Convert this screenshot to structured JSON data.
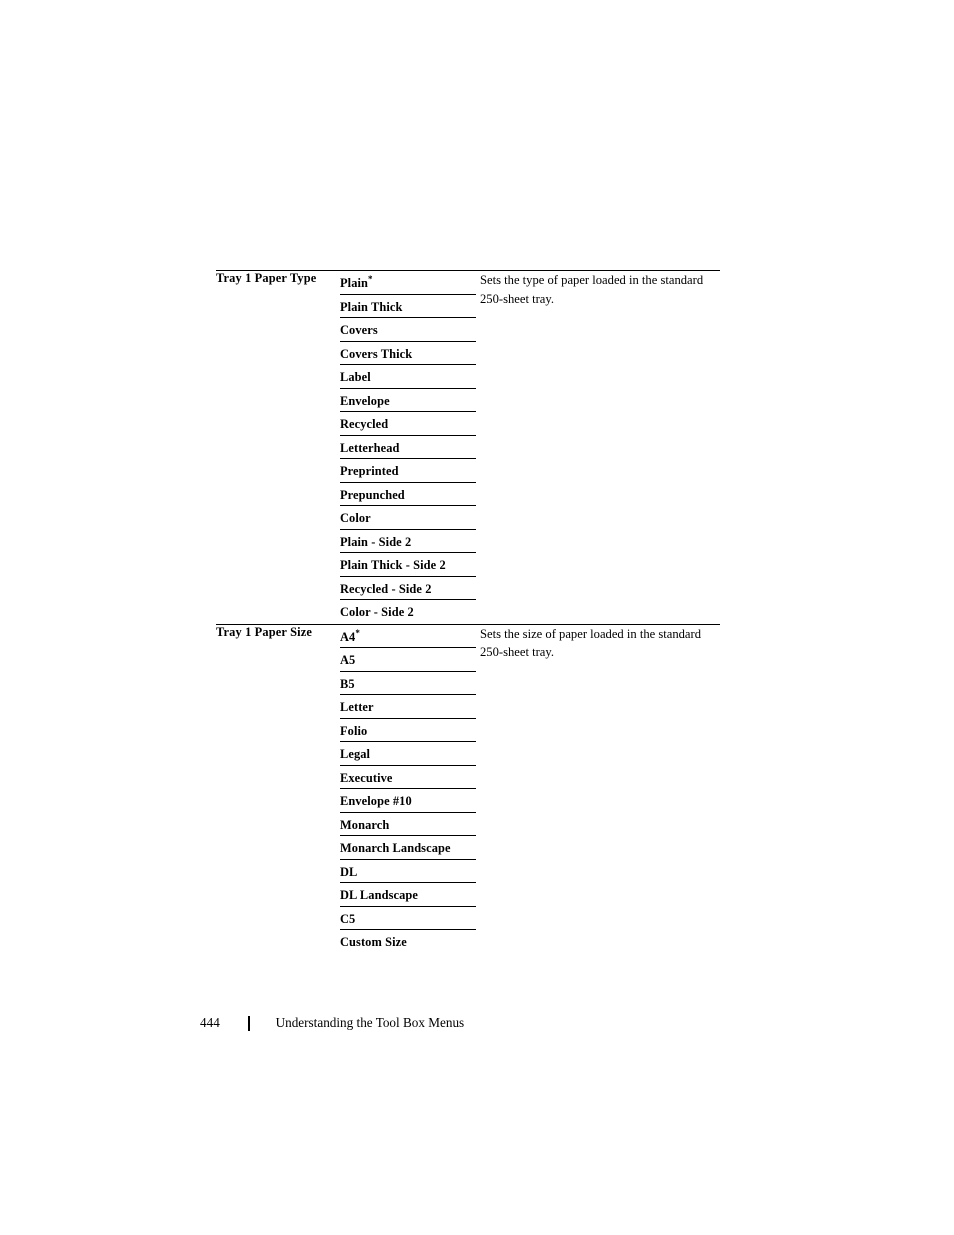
{
  "page": {
    "number": "444",
    "footer_title": "Understanding the Tool Box Menus",
    "separator_glyph": "|"
  },
  "table": {
    "sections": [
      {
        "setting": "Tray 1 Paper Type",
        "description": "Sets the type of paper loaded in the standard 250-sheet tray.",
        "default_marker": "*",
        "options": [
          {
            "label": "Plain",
            "is_default": true
          },
          {
            "label": "Plain Thick",
            "is_default": false
          },
          {
            "label": "Covers",
            "is_default": false
          },
          {
            "label": "Covers Thick",
            "is_default": false
          },
          {
            "label": "Label",
            "is_default": false
          },
          {
            "label": "Envelope",
            "is_default": false
          },
          {
            "label": "Recycled",
            "is_default": false
          },
          {
            "label": "Letterhead",
            "is_default": false
          },
          {
            "label": "Preprinted",
            "is_default": false
          },
          {
            "label": "Prepunched",
            "is_default": false
          },
          {
            "label": "Color",
            "is_default": false
          },
          {
            "label": "Plain - Side 2",
            "is_default": false
          },
          {
            "label": "Plain Thick - Side 2",
            "is_default": false
          },
          {
            "label": "Recycled - Side 2",
            "is_default": false
          },
          {
            "label": "Color - Side 2",
            "is_default": false
          }
        ]
      },
      {
        "setting": "Tray 1 Paper Size",
        "description": "Sets the size of paper loaded in the standard 250-sheet tray.",
        "default_marker": "*",
        "options": [
          {
            "label": "A4",
            "is_default": true
          },
          {
            "label": "A5",
            "is_default": false
          },
          {
            "label": "B5",
            "is_default": false
          },
          {
            "label": "Letter",
            "is_default": false
          },
          {
            "label": "Folio",
            "is_default": false
          },
          {
            "label": "Legal",
            "is_default": false
          },
          {
            "label": "Executive",
            "is_default": false
          },
          {
            "label": "Envelope #10",
            "is_default": false
          },
          {
            "label": "Monarch",
            "is_default": false
          },
          {
            "label": "Monarch Landscape",
            "is_default": false
          },
          {
            "label": "DL",
            "is_default": false
          },
          {
            "label": "DL Landscape",
            "is_default": false
          },
          {
            "label": "C5",
            "is_default": false
          },
          {
            "label": "Custom Size",
            "is_default": false
          }
        ]
      }
    ]
  }
}
